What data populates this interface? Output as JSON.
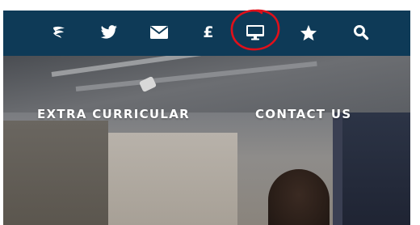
{
  "colors": {
    "icon_bar_bg": "#0e3a57",
    "icon_color": "#ffffff",
    "annotation": "#e0101a"
  },
  "icon_bar": {
    "icons": [
      {
        "name": "school-crest-icon"
      },
      {
        "name": "twitter-icon"
      },
      {
        "name": "mail-icon"
      },
      {
        "name": "pound-icon",
        "glyph": "£"
      },
      {
        "name": "monitor-icon",
        "annotated": true
      },
      {
        "name": "star-icon"
      },
      {
        "name": "search-icon"
      }
    ]
  },
  "nav": {
    "extra_curricular": "EXTRA CURRICULAR",
    "contact_us": "CONTACT US"
  }
}
